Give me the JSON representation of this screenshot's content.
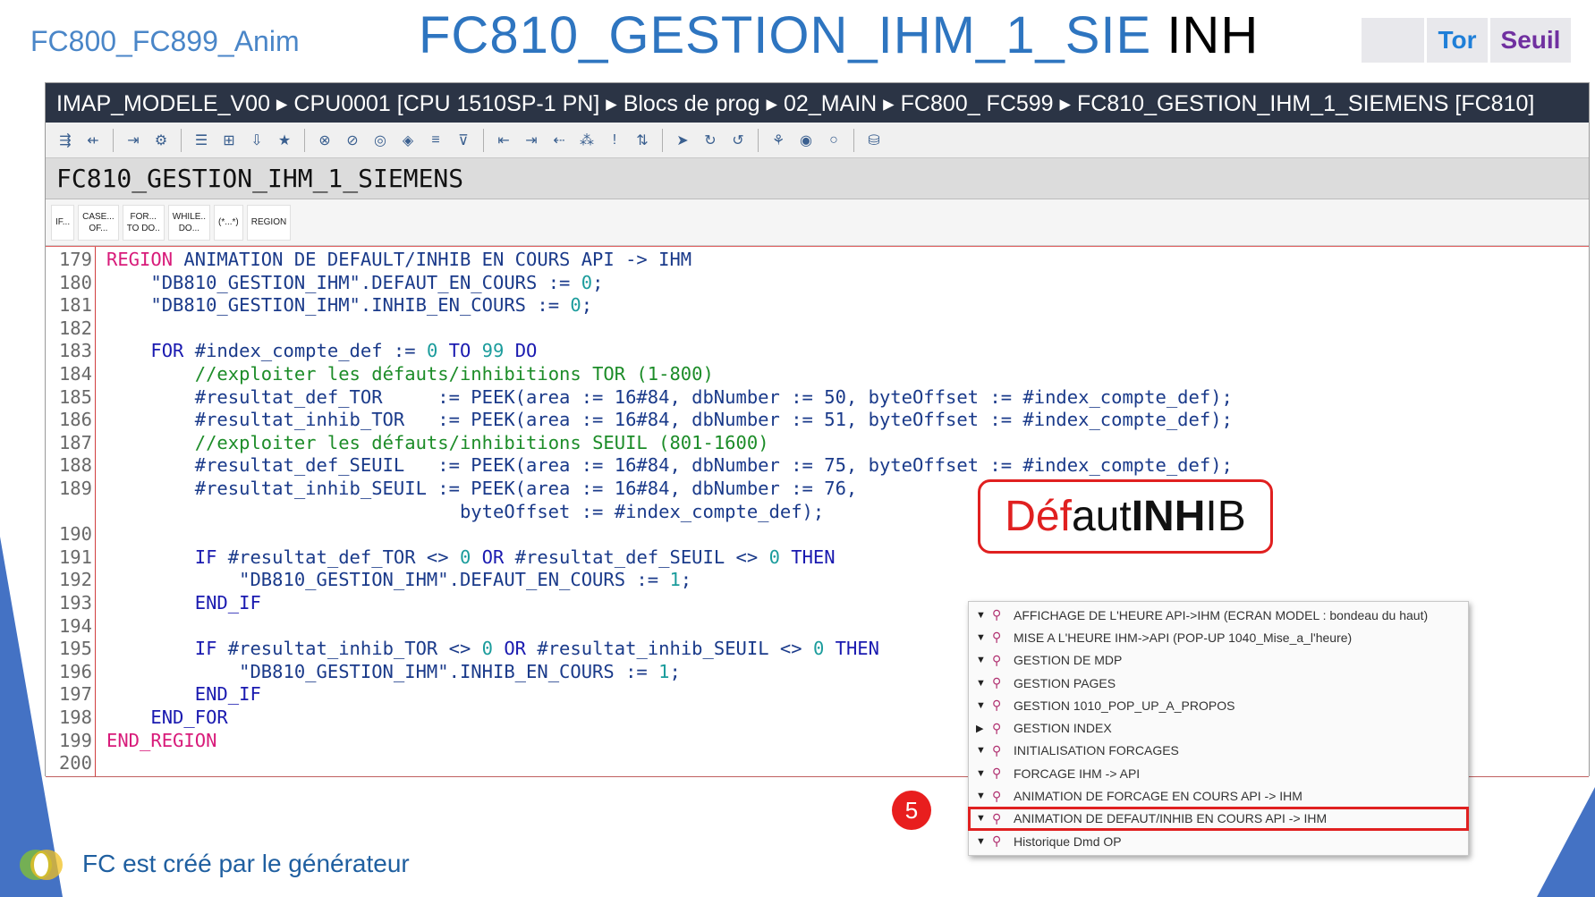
{
  "header": {
    "left_title": "FC800_FC899_Anim",
    "title_main": "FC810_GESTION_IHM_1_SIE",
    "title_suffix": " INH",
    "mini_table": {
      "col1": "Tor",
      "col2": "Seuil"
    }
  },
  "breadcrumb": "IMAP_MODELE_V00 ▸ CPU0001 [CPU 1510SP-1 PN] ▸ Blocs de prog ▸ 02_MAIN ▸ FC800_ FC599  ▸ FC810_GESTION_IHM_1_SIEMENS [FC810]",
  "block_title": "FC810_GESTION_IHM_1_SIEMENS",
  "snippets": [
    "IF...",
    "CASE...\nOF...",
    "FOR...\nTO DO..",
    "WHILE..\nDO...",
    "(*...*)",
    "REGION"
  ],
  "code_lines": [
    {
      "n": "179",
      "html": "<span class='rg'>REGION</span> ANIMATION DE DEFAULT/INHIB EN COURS API -> IHM"
    },
    {
      "n": "180",
      "html": "    <span class='st'>\"DB810_GESTION_IHM\"</span>.DEFAUT_EN_COURS := <span class='nm'>0</span>;"
    },
    {
      "n": "181",
      "html": "    <span class='st'>\"DB810_GESTION_IHM\"</span>.INHIB_EN_COURS := <span class='nm'>0</span>;"
    },
    {
      "n": "182",
      "html": ""
    },
    {
      "n": "183",
      "html": "    <span class='kw'>FOR</span> #index_compte_def := <span class='nm'>0</span> <span class='kw'>TO</span> <span class='nm'>99</span> <span class='kw'>DO</span>"
    },
    {
      "n": "184",
      "html": "        <span class='cm'>//exploiter les défauts/inhibitions TOR (1-800)</span>"
    },
    {
      "n": "185",
      "html": "        #resultat_def_TOR     := PEEK(area := 16#84, dbNumber := 50, byteOffset := #index_compte_def);"
    },
    {
      "n": "186",
      "html": "        #resultat_inhib_TOR   := PEEK(area := 16#84, dbNumber := 51, byteOffset := #index_compte_def);"
    },
    {
      "n": "187",
      "html": "        <span class='cm'>//exploiter les défauts/inhibitions SEUIL (801-1600)</span>"
    },
    {
      "n": "188",
      "html": "        #resultat_def_SEUIL   := PEEK(area := 16#84, dbNumber := 75, byteOffset := #index_compte_def);"
    },
    {
      "n": "189",
      "html": "        #resultat_inhib_SEUIL := PEEK(area := 16#84, dbNumber := 76,"
    },
    {
      "n": "",
      "html": "                                byteOffset := #index_compte_def);"
    },
    {
      "n": "190",
      "html": ""
    },
    {
      "n": "191",
      "html": "        <span class='kw'>IF</span> #resultat_def_TOR &lt;&gt; <span class='nm'>0</span> <span class='kw'>OR</span> #resultat_def_SEUIL &lt;&gt; <span class='nm'>0</span> <span class='kw'>THEN</span>"
    },
    {
      "n": "192",
      "html": "            <span class='st'>\"DB810_GESTION_IHM\"</span>.DEFAUT_EN_COURS := <span class='nm'>1</span>;"
    },
    {
      "n": "193",
      "html": "        <span class='kw'>END_IF</span>"
    },
    {
      "n": "194",
      "html": ""
    },
    {
      "n": "195",
      "html": "        <span class='kw'>IF</span> #resultat_inhib_TOR &lt;&gt; <span class='nm'>0</span> <span class='kw'>OR</span> #resultat_inhib_SEUIL &lt;&gt; <span class='nm'>0</span> <span class='kw'>THEN</span>"
    },
    {
      "n": "196",
      "html": "            <span class='st'>\"DB810_GESTION_IHM\"</span>.INHIB_EN_COURS := <span class='nm'>1</span>;"
    },
    {
      "n": "197",
      "html": "        <span class='kw'>END_IF</span>"
    },
    {
      "n": "198",
      "html": "    <span class='kw'>END_FOR</span>"
    },
    {
      "n": "199",
      "html": "<span class='rg'>END_REGION</span>"
    },
    {
      "n": "200",
      "html": ""
    }
  ],
  "callout": {
    "part1": "Déf",
    "part2": "aut ",
    "part3": "INH",
    "part4": "IB"
  },
  "badge": "5",
  "region_list": [
    {
      "label": "AFFICHAGE DE L'HEURE API->IHM (ECRAN MODEL : bondeau du haut)",
      "expanded": true
    },
    {
      "label": "MISE A L'HEURE IHM->API (POP-UP 1040_Mise_a_l'heure)",
      "expanded": true
    },
    {
      "label": "GESTION DE MDP",
      "expanded": true
    },
    {
      "label": "GESTION PAGES",
      "expanded": true
    },
    {
      "label": "GESTION 1010_POP_UP_A_PROPOS",
      "expanded": true
    },
    {
      "label": "GESTION INDEX",
      "expanded": false
    },
    {
      "label": "INITIALISATION FORCAGES",
      "expanded": true
    },
    {
      "label": "FORCAGE IHM -> API",
      "expanded": true
    },
    {
      "label": "ANIMATION DE FORCAGE EN COURS API -> IHM",
      "expanded": true
    },
    {
      "label": "ANIMATION DE DEFAUT/INHIB EN COURS API -> IHM",
      "expanded": true,
      "highlighted": true
    },
    {
      "label": "Historique Dmd OP",
      "expanded": true
    }
  ],
  "footer": "FC est créé par le générateur",
  "colors": {
    "accent": "#2e75c0",
    "highlight": "#e02020",
    "breadcrumb_bg": "#2b3445"
  }
}
